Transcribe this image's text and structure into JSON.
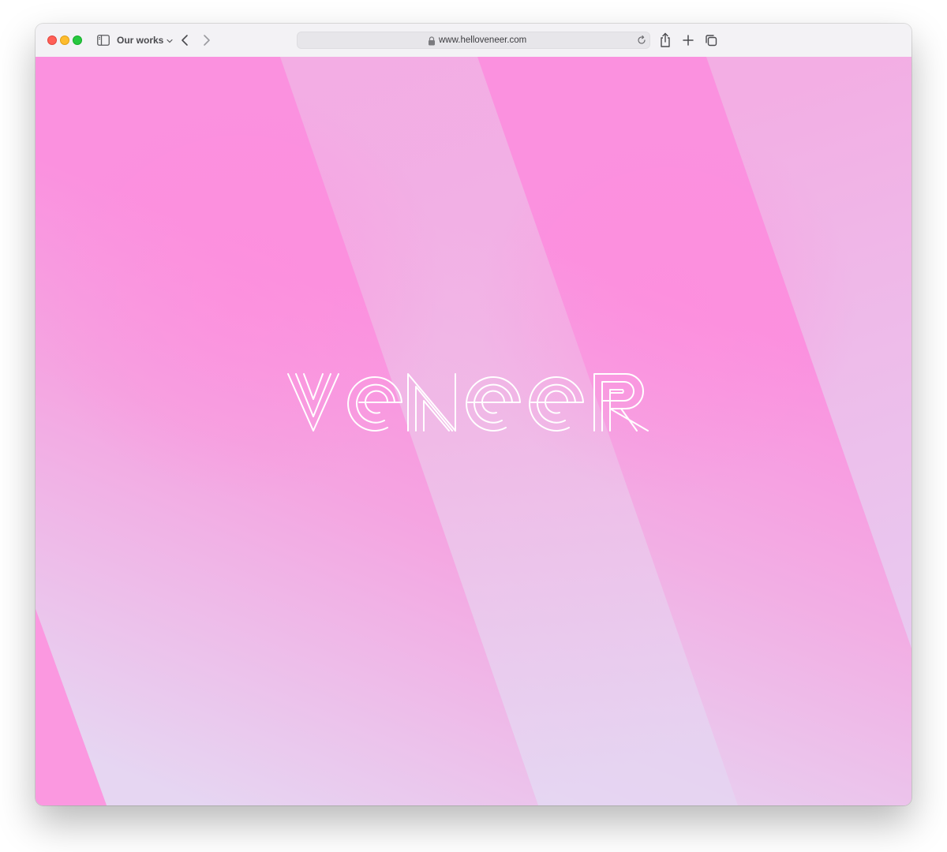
{
  "browser": {
    "tab_title": "Our works",
    "url": "www.helloveneer.com"
  },
  "site": {
    "logo_text": "veneer"
  },
  "colors": {
    "pink": "#fb91df",
    "lavender": "#e6d4f3",
    "logo_stroke": "#ffffff"
  },
  "icons": {
    "sidebar": "sidebar-icon",
    "back": "chevron-left-icon",
    "forward": "chevron-right-icon",
    "lock": "lock-icon",
    "reload": "reload-icon",
    "share": "share-icon",
    "new_tab": "plus-icon",
    "tab_overview": "tabs-icon"
  }
}
